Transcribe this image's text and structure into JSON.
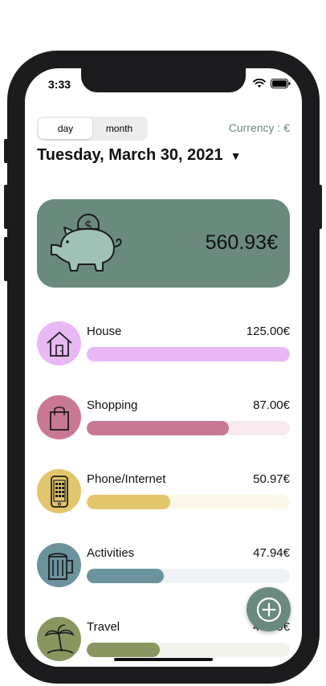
{
  "status_bar": {
    "time": "3:33"
  },
  "segmented": {
    "day": "day",
    "month": "month",
    "selected": "day"
  },
  "currency_label": "Currency : €",
  "date": {
    "text": "Tuesday, March 30, 2021",
    "caret": "▼"
  },
  "total": {
    "amount": "560.93€",
    "icon": "piggy-bank-icon"
  },
  "categories": [
    {
      "name": "House",
      "amount": "125.00€",
      "icon": "house-icon",
      "color": "#e8b8f5",
      "track": "#f3e0fa",
      "fill": 1.0
    },
    {
      "name": "Shopping",
      "amount": "87.00€",
      "icon": "shopping-bag-icon",
      "color": "#c97893",
      "track": "#f7e9ee",
      "fill": 0.7
    },
    {
      "name": "Phone/Internet",
      "amount": "50.97€",
      "icon": "phone-icon",
      "color": "#e3c56c",
      "track": "#faf6e8",
      "fill": 0.41
    },
    {
      "name": "Activities",
      "amount": "47.94€",
      "icon": "beer-mug-icon",
      "color": "#6a939c",
      "track": "#eef2f4",
      "fill": 0.38
    },
    {
      "name": "Travel",
      "amount": "45.00€",
      "icon": "palm-tree-icon",
      "color": "#8a9660",
      "track": "#f1f3ea",
      "fill": 0.36
    }
  ],
  "fab": {
    "icon": "plus-icon"
  }
}
